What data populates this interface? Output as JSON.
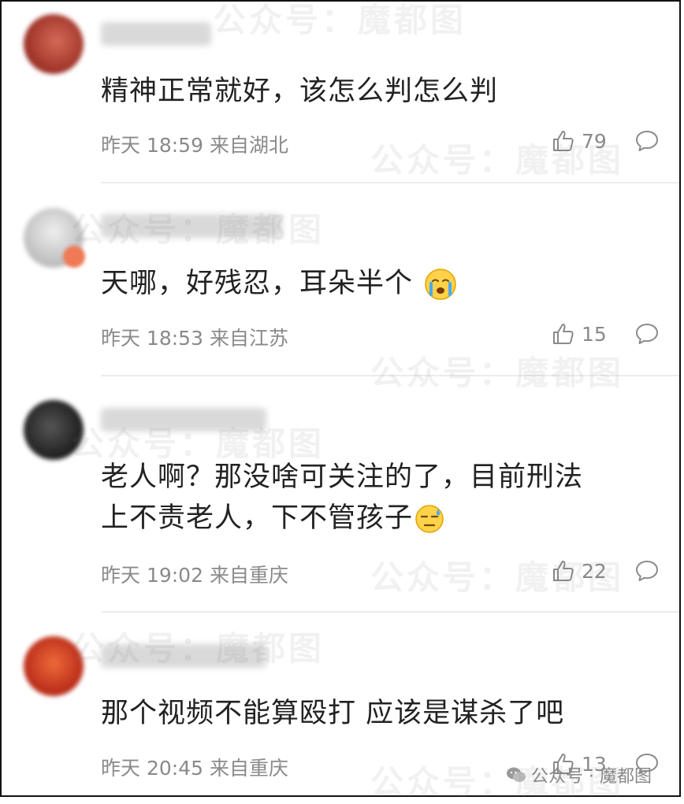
{
  "comments": [
    {
      "content_lines": [
        "精神正常就好，该怎么判怎么判"
      ],
      "time": "昨天 18:59",
      "location": "来自湖北",
      "likes": "79",
      "emoji": "",
      "avatar_color": "#b94a3a"
    },
    {
      "content_lines": [
        "天哪，好残忍，耳朵半个"
      ],
      "time": "昨天 18:53",
      "location": "来自江苏",
      "likes": "15",
      "emoji": "crying-face",
      "avatar_color": "#c9c9c9"
    },
    {
      "content_lines": [
        "老人啊？那没啥可关注的了，目前刑法",
        "上不责老人，下不管孩子"
      ],
      "time": "昨天 19:02",
      "location": "来自重庆",
      "likes": "22",
      "emoji": "sweat-face",
      "avatar_color": "#2a2a2a"
    },
    {
      "content_lines": [
        "那个视频不能算殴打 应该是谋杀了吧"
      ],
      "time": "昨天 20:45",
      "location": "来自重庆",
      "likes": "13",
      "emoji": "",
      "avatar_color": "#d9452a"
    }
  ],
  "watermark": "公众号：魔都图",
  "signature": "公众号 · 魔都图",
  "colors": {
    "text": "#222222",
    "meta": "#8a8a8a",
    "divider": "#ececec"
  }
}
